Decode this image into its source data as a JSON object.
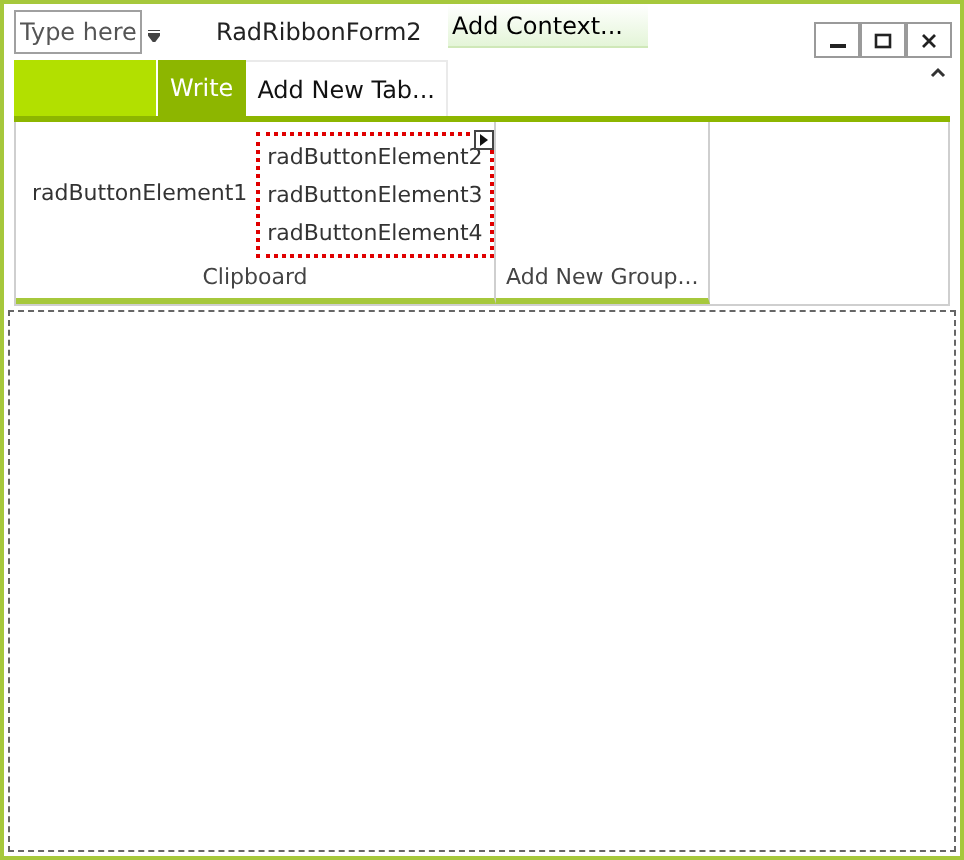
{
  "quick_access": {
    "field": {
      "placeholder": "Type here"
    }
  },
  "window": {
    "title": "RadRibbonForm2",
    "context": "Add Context..."
  },
  "tabs": [
    {
      "label": "Write",
      "selected": true
    },
    {
      "label": "Add New Tab...",
      "selected": false
    }
  ],
  "groups": [
    {
      "label": "Clipboard",
      "large_button": "radButtonElement1",
      "stack": [
        "radButtonElement2",
        "radButtonElement3",
        "radButtonElement4"
      ]
    },
    {
      "label": "Add New Group..."
    }
  ]
}
